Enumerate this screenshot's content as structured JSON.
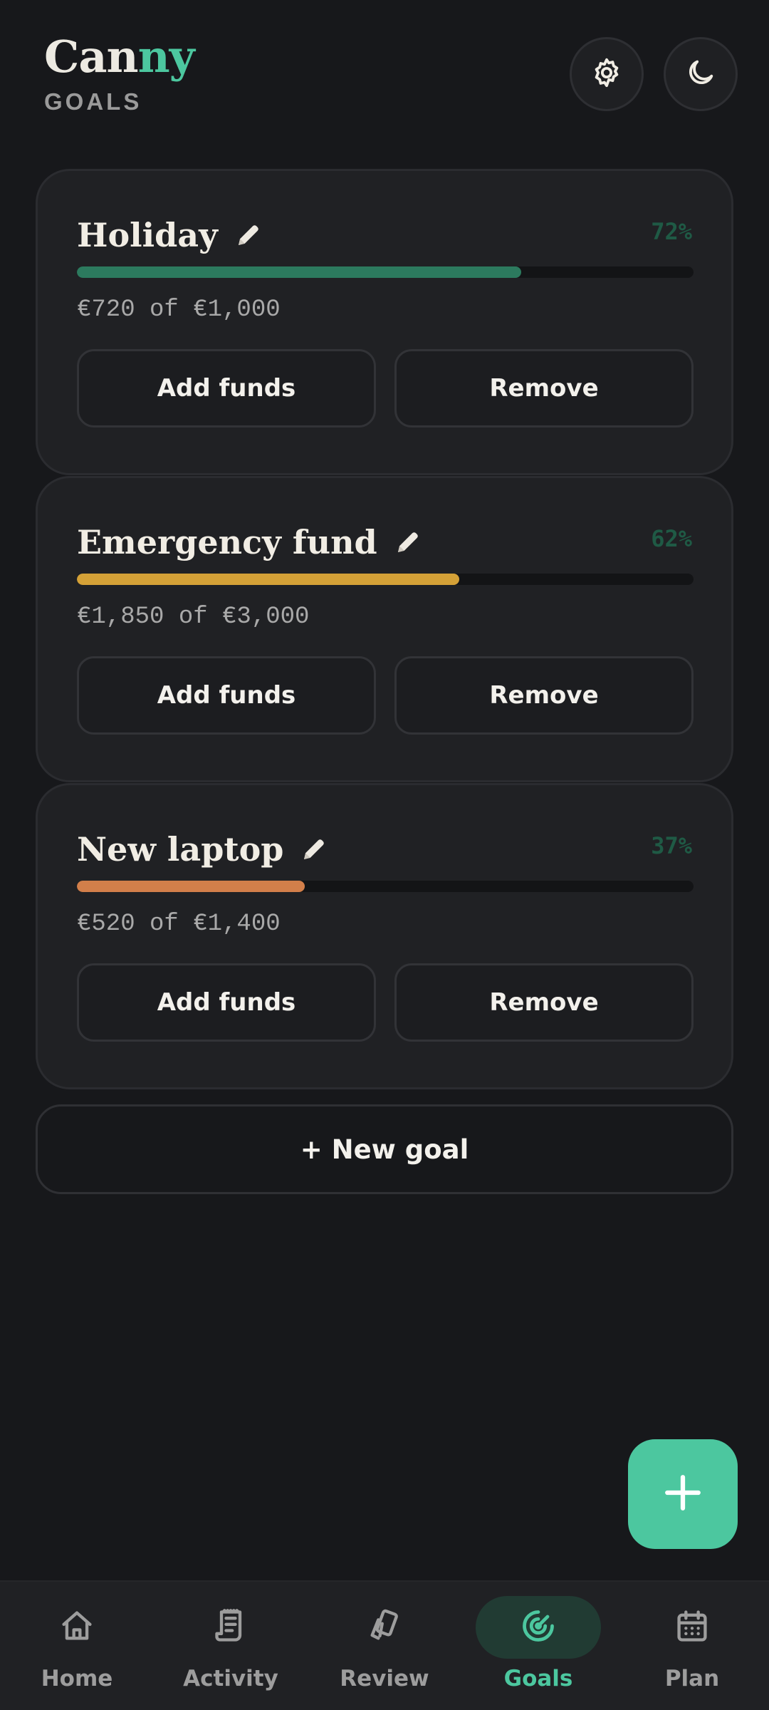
{
  "app": {
    "brand_main": "Can",
    "brand_accent": "ny",
    "section": "GOALS"
  },
  "header": {
    "settings_icon": "gear-icon",
    "theme_icon": "moon-icon"
  },
  "goals": [
    {
      "name": "Holiday",
      "percent_label": "72%",
      "progress": 0.72,
      "amount": "€720 of €1,000",
      "color": "#2c7a5e",
      "add_label": "Add funds",
      "remove_label": "Remove"
    },
    {
      "name": "Emergency fund",
      "percent_label": "62%",
      "progress": 0.62,
      "amount": "€1,850 of €3,000",
      "color": "#d4a137",
      "add_label": "Add funds",
      "remove_label": "Remove"
    },
    {
      "name": "New laptop",
      "percent_label": "37%",
      "progress": 0.37,
      "amount": "€520 of €1,400",
      "color": "#d27f4a",
      "add_label": "Add funds",
      "remove_label": "Remove"
    }
  ],
  "new_goal_label": "+ New goal",
  "fab_icon": "plus-icon",
  "nav": [
    {
      "label": "Home",
      "icon": "home-icon",
      "active": false
    },
    {
      "label": "Activity",
      "icon": "receipt-icon",
      "active": false
    },
    {
      "label": "Review",
      "icon": "cards-icon",
      "active": false
    },
    {
      "label": "Goals",
      "icon": "target-icon",
      "active": true
    },
    {
      "label": "Plan",
      "icon": "calendar-icon",
      "active": false
    }
  ],
  "colors": {
    "accent": "#4cc79f",
    "background": "#17181b",
    "card": "#202124"
  }
}
